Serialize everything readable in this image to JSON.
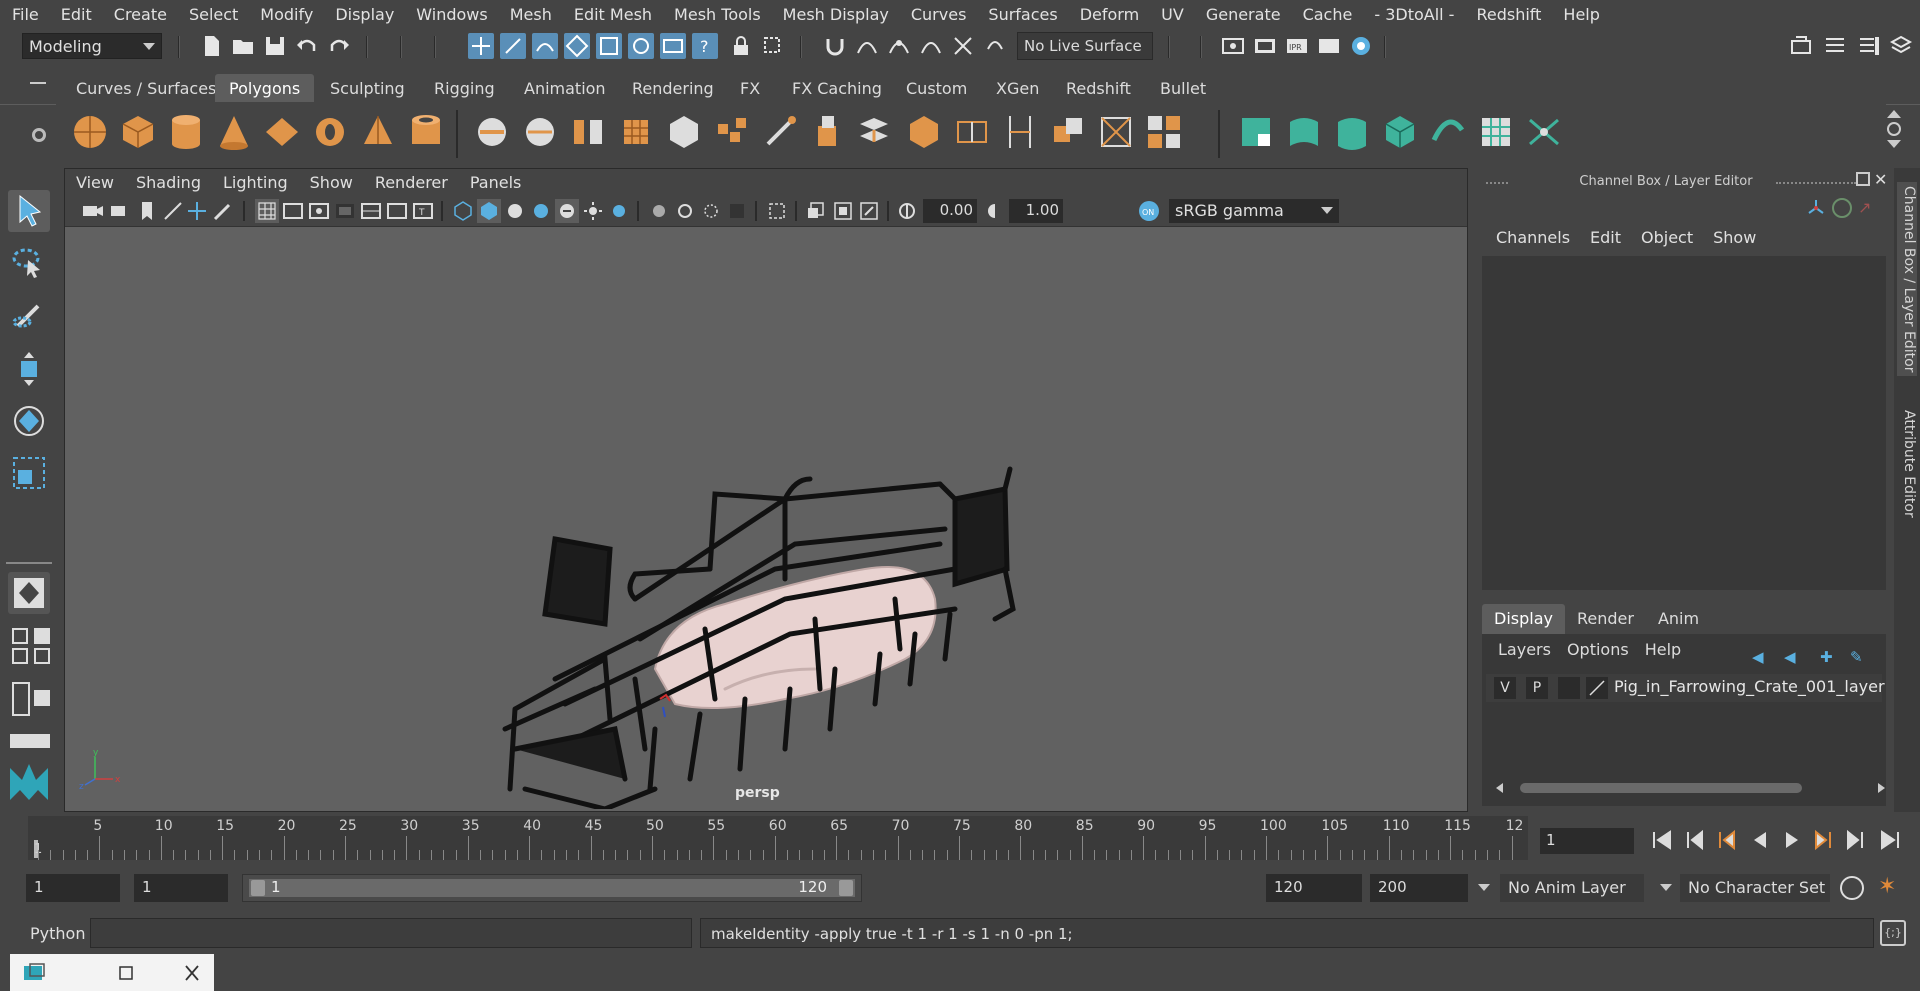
{
  "menubar": {
    "items": [
      "File",
      "Edit",
      "Create",
      "Select",
      "Modify",
      "Display",
      "Windows",
      "Mesh",
      "Edit Mesh",
      "Mesh Tools",
      "Mesh Display",
      "Curves",
      "Surfaces",
      "Deform",
      "UV",
      "Generate",
      "Cache",
      "- 3DtoAll -",
      "Redshift",
      "Help"
    ]
  },
  "statusline": {
    "mode": "Modeling",
    "live_surface": "No Live Surface"
  },
  "shelf": {
    "tabs": [
      "Curves / Surfaces",
      "Polygons",
      "Sculpting",
      "Rigging",
      "Animation",
      "Rendering",
      "FX",
      "FX Caching",
      "Custom",
      "XGen",
      "Redshift",
      "Bullet"
    ],
    "active_tab": "Polygons"
  },
  "viewport": {
    "menu": [
      "View",
      "Shading",
      "Lighting",
      "Show",
      "Renderer",
      "Panels"
    ],
    "exposure": "0.00",
    "gamma": "1.00",
    "color_space": "sRGB gamma",
    "camera": "persp",
    "axis_x": "x",
    "axis_y": "y",
    "axis_z": "z"
  },
  "channel_box": {
    "title": "Channel Box / Layer Editor",
    "menu": [
      "Channels",
      "Edit",
      "Object",
      "Show"
    ]
  },
  "layer_editor": {
    "tabs": [
      "Display",
      "Render",
      "Anim"
    ],
    "active_tab": "Display",
    "menu": [
      "Layers",
      "Options",
      "Help"
    ],
    "layer": {
      "v": "V",
      "p": "P",
      "name": "Pig_in_Farrowing_Crate_001_layer"
    }
  },
  "side_tabs": [
    "Channel Box / Layer Editor",
    "Attribute Editor"
  ],
  "timeline": {
    "ticks": [
      "5",
      "10",
      "15",
      "20",
      "25",
      "30",
      "35",
      "40",
      "45",
      "50",
      "55",
      "60",
      "65",
      "70",
      "75",
      "80",
      "85",
      "90",
      "95",
      "100",
      "105",
      "110",
      "115",
      "12"
    ],
    "start_marker": "1",
    "current_frame": "1"
  },
  "range": {
    "start": "1",
    "anim_start": "1",
    "slider_start": "1",
    "slider_end": "120",
    "anim_end": "120",
    "end": "200",
    "anim_layer": "No Anim Layer",
    "character_set": "No Character Set"
  },
  "command_line": {
    "language": "Python",
    "result": "makeIdentity -apply true -t 1 -r 1 -s 1 -n 0 -pn 1;"
  },
  "colors": {
    "accent_blue": "#5a8fb8",
    "shelf_orange": "#e0954a",
    "shelf_teal": "#3fb39c",
    "viewport_bg": "#616161"
  }
}
